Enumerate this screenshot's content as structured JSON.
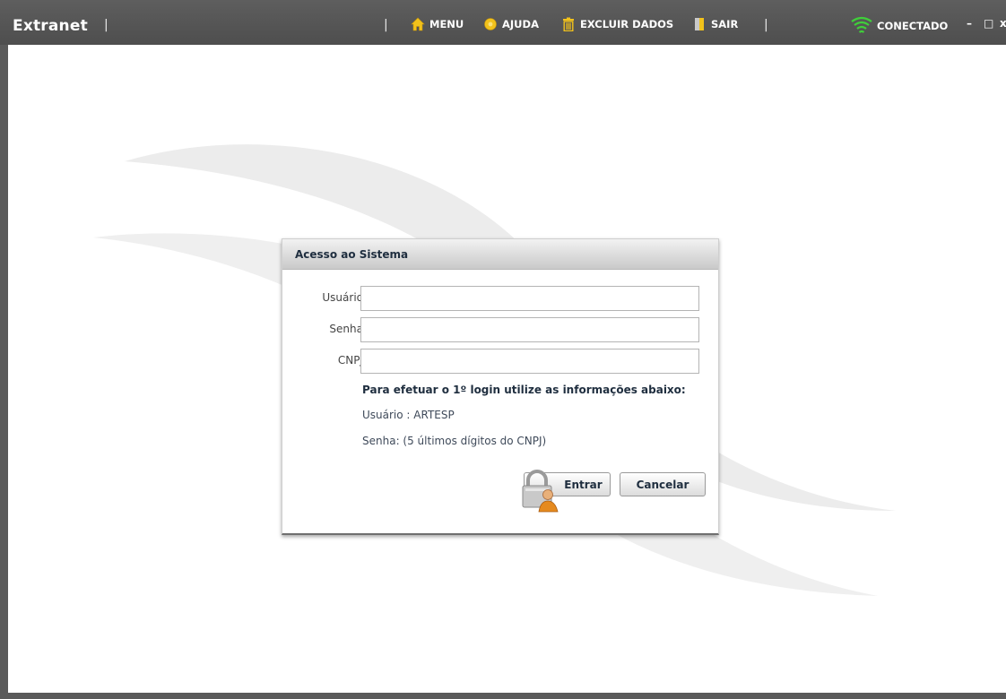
{
  "app": {
    "title": "Extranet",
    "separator": "|"
  },
  "topbar": {
    "menu_items": [
      {
        "label": "MENU",
        "icon": "home-icon"
      },
      {
        "label": "AJUDA",
        "icon": "help-icon"
      },
      {
        "label": "EXCLUIR DADOS",
        "icon": "trash-icon"
      },
      {
        "label": "SAIR",
        "icon": "exit-door-icon"
      }
    ],
    "connection_status": "CONECTADO",
    "window_controls": {
      "minimize": "–",
      "maximize": "□",
      "close": "x"
    }
  },
  "dialog": {
    "title": "Acesso ao Sistema",
    "fields": [
      {
        "label": "Usuário",
        "value": "",
        "placeholder": ""
      },
      {
        "label": "Senha",
        "value": "",
        "placeholder": ""
      },
      {
        "label": "CNPJ",
        "value": "",
        "placeholder": ""
      }
    ],
    "info": {
      "heading": "Para efetuar o 1º login utilize as informações abaixo:",
      "user_line": "Usuário : ARTESP",
      "password_line": "Senha: (5 últimos dígitos do CNPJ)"
    },
    "buttons": {
      "submit": "Entrar",
      "cancel": "Cancelar"
    }
  },
  "colors": {
    "topbar": "#555555",
    "accent_yellow": "#f2c21b",
    "signal_green": "#3fcf3a",
    "dialog_title_text": "#1f2e3f"
  }
}
